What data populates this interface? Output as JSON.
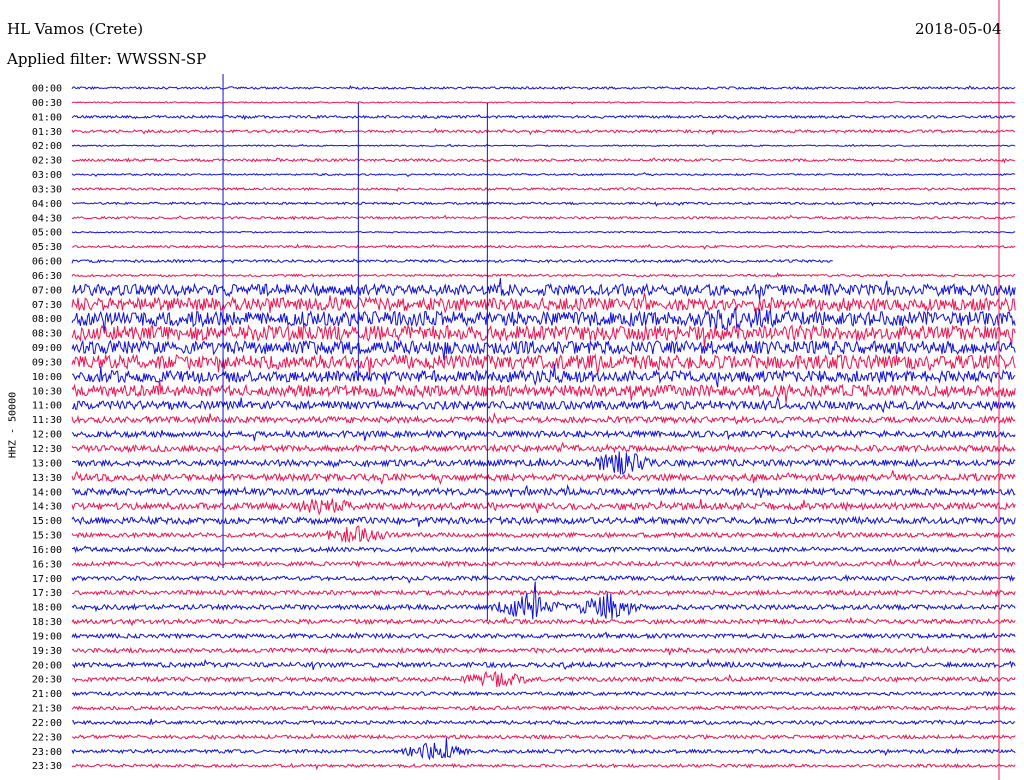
{
  "header": {
    "station": "HL Vamos (Crete)",
    "date": "2018-05-04",
    "filter": "Applied filter: WWSSN-SP"
  },
  "chart_data": {
    "type": "line",
    "title": "HL Vamos (Crete)",
    "date": "2018-05-04",
    "filter": "WWSSN-SP",
    "ylabel": "HHZ - 50000",
    "series_colors": [
      "#1010d8",
      "#ee1450"
    ],
    "row_labels": [
      "00:00",
      "00:30",
      "01:00",
      "01:30",
      "02:00",
      "02:30",
      "03:00",
      "03:30",
      "04:00",
      "04:30",
      "05:00",
      "05:30",
      "06:00",
      "06:30",
      "07:00",
      "07:30",
      "08:00",
      "08:30",
      "09:00",
      "09:30",
      "10:00",
      "10:30",
      "11:00",
      "11:30",
      "12:00",
      "12:30",
      "13:00",
      "13:30",
      "14:00",
      "14:30",
      "15:00",
      "15:30",
      "16:00",
      "16:30",
      "17:00",
      "17:30",
      "18:00",
      "18:30",
      "19:00",
      "19:30",
      "20:00",
      "20:30",
      "21:00",
      "21:30",
      "22:00",
      "22:30",
      "23:00",
      "23:30"
    ],
    "relative_amplitude": [
      0.5,
      0.3,
      0.6,
      0.6,
      0.3,
      0.6,
      0.4,
      0.5,
      0.5,
      0.5,
      0.3,
      0.5,
      0.6,
      0.5,
      2.6,
      3.0,
      3.3,
      3.4,
      3.0,
      3.2,
      2.6,
      2.6,
      1.9,
      1.4,
      1.4,
      1.4,
      1.4,
      1.5,
      1.5,
      1.5,
      1.5,
      1.0,
      1.0,
      1.0,
      1.0,
      1.0,
      1.1,
      1.0,
      1.0,
      1.0,
      1.1,
      1.0,
      0.8,
      0.8,
      0.8,
      0.8,
      0.8,
      0.7
    ],
    "events": [
      {
        "row": 0,
        "minute": 4.8,
        "amplitude": 1.0,
        "type": "spike"
      },
      {
        "row": 2,
        "minute": 9.1,
        "amplitude": 0.55,
        "type": "spike"
      },
      {
        "row": 2,
        "minute": 13.2,
        "amplitude": 1.05,
        "type": "spike"
      },
      {
        "row": 16,
        "minute": 21.2,
        "amplitude": 0.8,
        "type": "burst"
      },
      {
        "row": 26,
        "minute": 17.5,
        "amplitude": 1.2,
        "type": "burst"
      },
      {
        "row": 29,
        "minute": 8.0,
        "amplitude": 0.7,
        "type": "burst"
      },
      {
        "row": 31,
        "minute": 9.0,
        "amplitude": 0.9,
        "type": "burst"
      },
      {
        "row": 36,
        "minute": 14.5,
        "amplitude": 1.4,
        "type": "burst"
      },
      {
        "row": 36,
        "minute": 17.0,
        "amplitude": 1.4,
        "type": "burst"
      },
      {
        "row": 41,
        "minute": 13.5,
        "amplitude": 0.9,
        "type": "burst"
      },
      {
        "row": 46,
        "minute": 11.5,
        "amplitude": 0.9,
        "type": "burst"
      }
    ],
    "gaps": [
      {
        "row": 12,
        "from_minute": 24.2,
        "to_minute": 30
      }
    ],
    "grid": false
  }
}
